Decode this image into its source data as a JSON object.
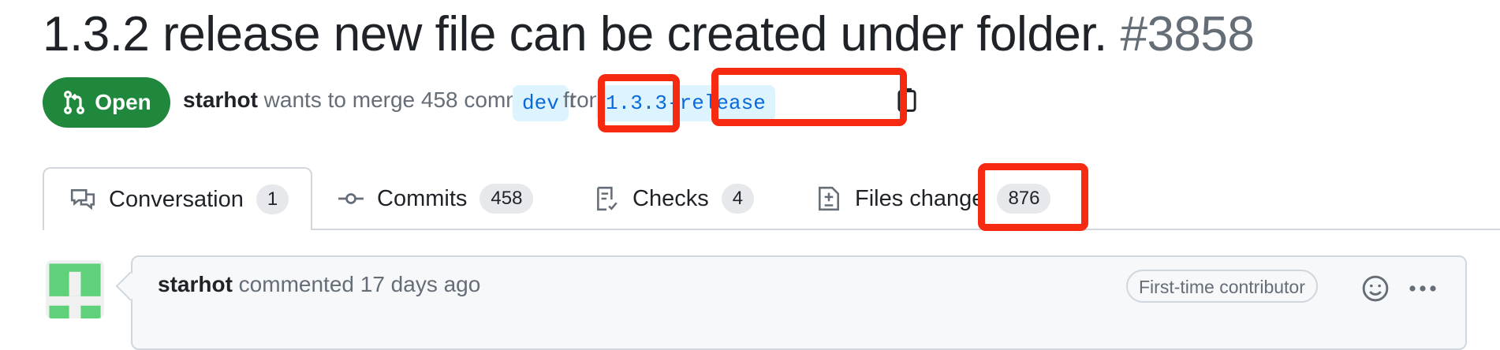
{
  "pr": {
    "title": "1.3.2 release new file can be created under folder.",
    "number": "#3858",
    "state": "Open",
    "author": "starhot",
    "meta_middle": " wants to merge 458 commits int",
    "base_branch": "dev",
    "from_text": "fron",
    "head_branch": "1.3.3-release"
  },
  "tabs": [
    {
      "label": "Conversation",
      "count": "1"
    },
    {
      "label": "Commits",
      "count": "458"
    },
    {
      "label": "Checks",
      "count": "4"
    },
    {
      "label": "Files change",
      "count": "876"
    }
  ],
  "comment": {
    "author": "starhot",
    "action": " commented 17 days ago",
    "badge": "First-time contributor"
  },
  "colors": {
    "open_green": "#1f883d",
    "highlight_red": "#f52a10",
    "branch_blue": "#0969da"
  }
}
